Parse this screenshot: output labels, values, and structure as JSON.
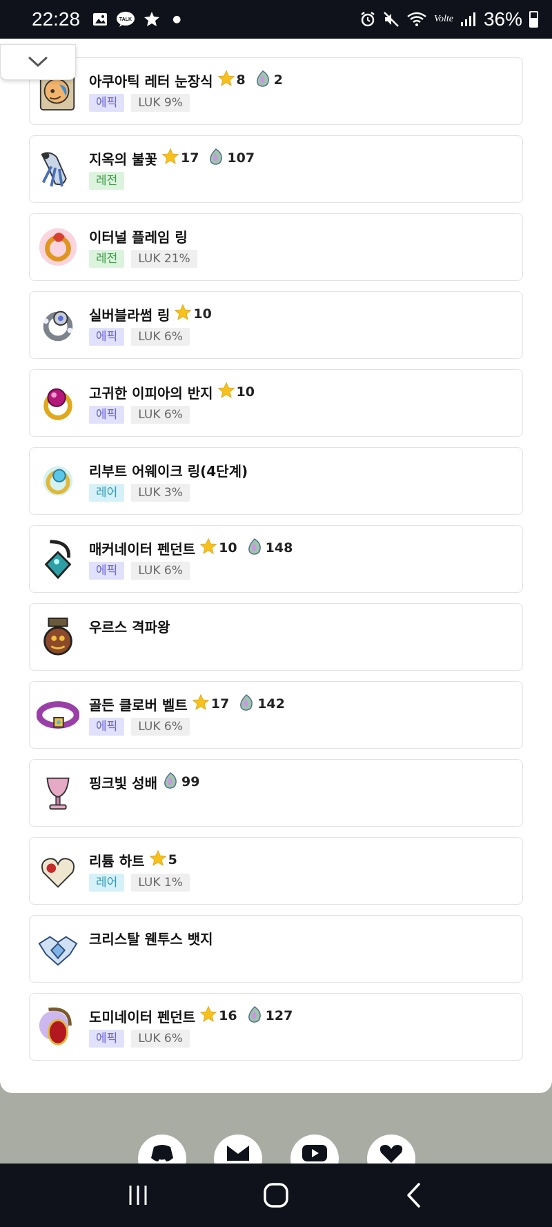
{
  "status_bar": {
    "time": "22:28",
    "left_icons": [
      "gallery-icon",
      "kakaotalk-icon",
      "badge-icon",
      "dot-icon"
    ],
    "right_icons": [
      "alarm-icon",
      "mute-icon",
      "wifi-icon",
      "volte-icon",
      "signal-icon"
    ],
    "talk_label": "TALK",
    "volte_label": "Volte",
    "battery": "36%"
  },
  "items": [
    {
      "name": "아쿠아틱 레터 눈장식",
      "icon": "aquatic-letter-eye-icon",
      "stars": "8",
      "flames": "2",
      "tags": [
        {
          "text": "에픽",
          "kind": "epic"
        },
        {
          "text": "LUK 9%",
          "kind": "stat"
        }
      ]
    },
    {
      "name": "지옥의 불꽃",
      "icon": "hell-flame-earring-icon",
      "stars": "17",
      "flames": "107",
      "tags": [
        {
          "text": "레전",
          "kind": "legend"
        }
      ]
    },
    {
      "name": "이터널 플레임 링",
      "icon": "eternal-flame-ring-icon",
      "stars": null,
      "flames": null,
      "tags": [
        {
          "text": "레전",
          "kind": "legend"
        },
        {
          "text": "LUK 21%",
          "kind": "stat"
        }
      ]
    },
    {
      "name": "실버블라썸 링",
      "icon": "silver-blossom-ring-icon",
      "stars": "10",
      "flames": null,
      "tags": [
        {
          "text": "에픽",
          "kind": "epic"
        },
        {
          "text": "LUK 6%",
          "kind": "stat"
        }
      ]
    },
    {
      "name": "고귀한 이피아의 반지",
      "icon": "noble-ifia-ring-icon",
      "stars": "10",
      "flames": null,
      "tags": [
        {
          "text": "에픽",
          "kind": "epic"
        },
        {
          "text": "LUK 6%",
          "kind": "stat"
        }
      ]
    },
    {
      "name": "리부트 어웨이크 링(4단계)",
      "icon": "reboot-awake-ring-icon",
      "stars": null,
      "flames": null,
      "tags": [
        {
          "text": "레어",
          "kind": "rare"
        },
        {
          "text": "LUK 3%",
          "kind": "stat"
        }
      ]
    },
    {
      "name": "매커네이터 펜던트",
      "icon": "mechanator-pendant-icon",
      "stars": "10",
      "flames": "148",
      "tags": [
        {
          "text": "에픽",
          "kind": "epic"
        },
        {
          "text": "LUK 6%",
          "kind": "stat"
        }
      ]
    },
    {
      "name": "우르스 격파왕",
      "icon": "urus-medal-icon",
      "stars": null,
      "flames": null,
      "tags": []
    },
    {
      "name": "골든 클로버 벨트",
      "icon": "golden-clover-belt-icon",
      "stars": "17",
      "flames": "142",
      "tags": [
        {
          "text": "에픽",
          "kind": "epic"
        },
        {
          "text": "LUK 6%",
          "kind": "stat"
        }
      ]
    },
    {
      "name": "핑크빛 성배",
      "icon": "pink-holy-cup-icon",
      "stars": null,
      "flames": "99",
      "tags": []
    },
    {
      "name": "리튬 하트",
      "icon": "lithium-heart-icon",
      "stars": "5",
      "flames": null,
      "tags": [
        {
          "text": "레어",
          "kind": "rare"
        },
        {
          "text": "LUK 1%",
          "kind": "stat"
        }
      ]
    },
    {
      "name": "크리스탈 웬투스 뱃지",
      "icon": "crystal-ventus-badge-icon",
      "stars": null,
      "flames": null,
      "tags": []
    },
    {
      "name": "도미네이터 펜던트",
      "icon": "dominator-pendant-icon",
      "stars": "16",
      "flames": "127",
      "tags": [
        {
          "text": "에픽",
          "kind": "epic"
        },
        {
          "text": "LUK 6%",
          "kind": "stat"
        }
      ]
    }
  ],
  "footer": {
    "social": [
      "discord-icon",
      "mail-icon",
      "youtube-icon",
      "heart-icon"
    ]
  },
  "nav_bar": {
    "buttons": [
      "recent-apps-icon",
      "home-icon",
      "back-icon"
    ]
  },
  "colors": {
    "status_bg": "#0f121b",
    "epic_bg": "#e2e1fb",
    "epic_text": "#6b63d9",
    "legend_bg": "#dcf3dd",
    "legend_text": "#3e9a48",
    "rare_bg": "#d6f1f8",
    "rare_text": "#2d9bb9",
    "stat_bg": "#efefef",
    "stat_text": "#666666",
    "footer_bg": "#a8aca3"
  }
}
